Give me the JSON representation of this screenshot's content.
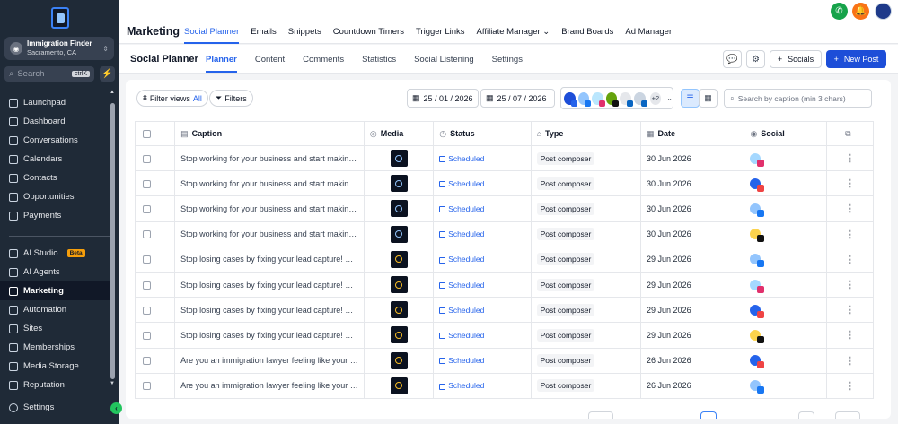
{
  "sidebar": {
    "account_name": "Immigration Finder",
    "account_location": "Sacramento, CA",
    "search_placeholder": "Search",
    "search_shortcut": "ctrlK",
    "nav_top": [
      {
        "label": "Launchpad",
        "icon": "rocket-icon"
      },
      {
        "label": "Dashboard",
        "icon": "dashboard-icon"
      },
      {
        "label": "Conversations",
        "icon": "chat-icon"
      },
      {
        "label": "Calendars",
        "icon": "calendar-icon"
      },
      {
        "label": "Contacts",
        "icon": "contacts-icon"
      },
      {
        "label": "Opportunities",
        "icon": "opportunities-icon"
      },
      {
        "label": "Payments",
        "icon": "payments-icon"
      }
    ],
    "nav_bottom": [
      {
        "label": "AI Studio",
        "icon": "ai-studio-icon",
        "badge": "Beta"
      },
      {
        "label": "AI Agents",
        "icon": "ai-agents-icon"
      },
      {
        "label": "Marketing",
        "icon": "marketing-icon"
      },
      {
        "label": "Automation",
        "icon": "automation-icon"
      },
      {
        "label": "Sites",
        "icon": "sites-icon"
      },
      {
        "label": "Memberships",
        "icon": "memberships-icon"
      },
      {
        "label": "Media Storage",
        "icon": "media-icon"
      },
      {
        "label": "Reputation",
        "icon": "reputation-icon"
      }
    ],
    "settings_label": "Settings"
  },
  "header": {
    "module_title": "Marketing",
    "tabs": [
      "Social Planner",
      "Emails",
      "Snippets",
      "Countdown Timers",
      "Trigger Links",
      "Affiliate Manager",
      "Brand Boards",
      "Ad Manager"
    ]
  },
  "subheader": {
    "title": "Social Planner",
    "tabs": [
      "Planner",
      "Content",
      "Comments",
      "Statistics",
      "Social Listening",
      "Settings"
    ],
    "socials_label": "Socials",
    "new_post_label": "New Post"
  },
  "toolbar": {
    "filter_views_label": "Filter views",
    "filter_views_value": "All",
    "filters_label": "Filters",
    "date_start": "25 / 01 / 2026",
    "date_end": "25 / 07 / 2026",
    "accounts_more": "+2",
    "search_placeholder": "Search by caption (min 3 chars)"
  },
  "table": {
    "headers": [
      "Caption",
      "Media",
      "Status",
      "Type",
      "Date",
      "Social"
    ],
    "rows": [
      {
        "caption": "Stop working for your business and start making y...",
        "status": "Scheduled",
        "type": "Post composer",
        "date": "30 Jun 2026",
        "social": "instagram",
        "media": "blue"
      },
      {
        "caption": "Stop working for your business and start making y...",
        "status": "Scheduled",
        "type": "Post composer",
        "date": "30 Jun 2026",
        "social": "youtube",
        "media": "blue"
      },
      {
        "caption": "Stop working for your business and start making y...",
        "status": "Scheduled",
        "type": "Post composer",
        "date": "30 Jun 2026",
        "social": "facebook",
        "media": "blue"
      },
      {
        "caption": "Stop working for your business and start making y...",
        "status": "Scheduled",
        "type": "Post composer",
        "date": "30 Jun 2026",
        "social": "tiktok",
        "media": "blue"
      },
      {
        "caption": "Stop losing cases by fixing your lead capture! Man...",
        "status": "Scheduled",
        "type": "Post composer",
        "date": "29 Jun 2026",
        "social": "facebook",
        "media": "dark"
      },
      {
        "caption": "Stop losing cases by fixing your lead capture! Man...",
        "status": "Scheduled",
        "type": "Post composer",
        "date": "29 Jun 2026",
        "social": "instagram",
        "media": "dark"
      },
      {
        "caption": "Stop losing cases by fixing your lead capture! Man...",
        "status": "Scheduled",
        "type": "Post composer",
        "date": "29 Jun 2026",
        "social": "youtube",
        "media": "dark"
      },
      {
        "caption": "Stop losing cases by fixing your lead capture! Man...",
        "status": "Scheduled",
        "type": "Post composer",
        "date": "29 Jun 2026",
        "social": "tiktok",
        "media": "dark"
      },
      {
        "caption": "Are you an immigration lawyer feeling like your b...",
        "status": "Scheduled",
        "type": "Post composer",
        "date": "26 Jun 2026",
        "social": "youtube",
        "media": "dark"
      },
      {
        "caption": "Are you an immigration lawyer feeling like your b...",
        "status": "Scheduled",
        "type": "Post composer",
        "date": "26 Jun 2026",
        "social": "facebook",
        "media": "dark"
      }
    ]
  },
  "colors": {
    "accent": "#2563eb",
    "sidebar_bg": "#1f2a37",
    "phone": "#16a34a",
    "notifications": "#f97316"
  }
}
